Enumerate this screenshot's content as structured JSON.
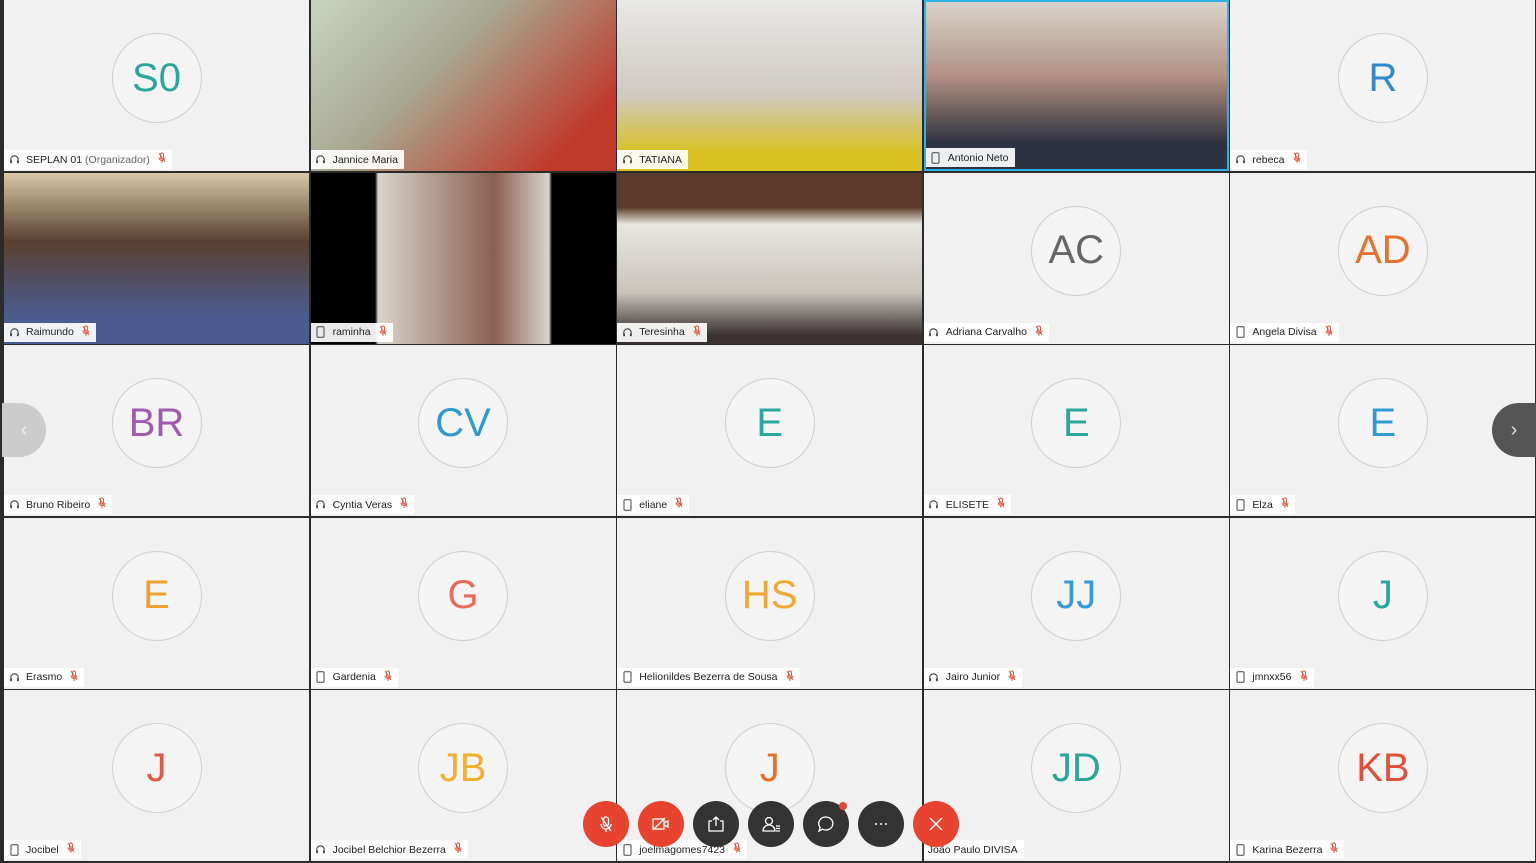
{
  "colors": {
    "active_border": "#2fb2e8",
    "red_button": "#e8432e",
    "dark_button": "#333333",
    "muted_mic": "#e0503a"
  },
  "participants": [
    {
      "name": "SEPLAN 01",
      "role": "(Organizador)",
      "initials": "S0",
      "color": "#2aa79b",
      "device": "headset",
      "muted": true
    },
    {
      "name": "Jannice Maria",
      "video": true,
      "bg": "linear-gradient(135deg,#c9d4c0,#a8a890 40%,#c0392b 85%)",
      "device": "headset",
      "muted": false
    },
    {
      "name": "TATIANA",
      "video": true,
      "bg": "linear-gradient(180deg,#e8e8e6,#cfcac2 55%,#d8c020 90%)",
      "device": "headset",
      "muted": false
    },
    {
      "name": "Antonio Neto",
      "video": true,
      "active": true,
      "bg": "linear-gradient(180deg,#d8d4cc,#b09080 45%,#2c3240 85%)",
      "device": "phone",
      "muted": false
    },
    {
      "name": "rebeca",
      "initials": "R",
      "color": "#2e8bcc",
      "device": "headset",
      "muted": true
    },
    {
      "name": "Raimundo",
      "video": true,
      "bg": "linear-gradient(180deg,#d8c8a8,#5a4030 40%,#4a5c90 85%)",
      "device": "headset",
      "muted": true
    },
    {
      "name": "raminha",
      "video": true,
      "bg": "linear-gradient(90deg,#000 21%,#d8d4cc 22%,#8a6050 60%,#d8d4cc 78%,#000 79%)",
      "device": "phone",
      "muted": true
    },
    {
      "name": "Teresinha",
      "video": true,
      "bg": "linear-gradient(180deg,#5a3a28 20%,#e8e6e0 30%,#c8c4bc 70%,#3a3030 95%)",
      "device": "headset",
      "muted": true
    },
    {
      "name": "Adriana Carvalho",
      "initials": "AC",
      "color": "#666666",
      "device": "headset",
      "muted": true
    },
    {
      "name": "Angela Divisa",
      "initials": "AD",
      "color": "#e8702a",
      "device": "phone",
      "muted": true
    },
    {
      "name": "Bruno Ribeiro",
      "initials": "BR",
      "color": "#a05bb0",
      "device": "headset",
      "muted": true
    },
    {
      "name": "Cyntia Veras",
      "initials": "CV",
      "color": "#2e9bd0",
      "device": "headset",
      "muted": true
    },
    {
      "name": "eliane",
      "initials": "E",
      "color": "#2aa79b",
      "device": "phone",
      "muted": true
    },
    {
      "name": "ELISETE",
      "initials": "E",
      "color": "#2aa79b",
      "device": "headset",
      "muted": true
    },
    {
      "name": "Elza",
      "initials": "E",
      "color": "#2e9bd0",
      "device": "phone",
      "muted": true
    },
    {
      "name": "Erasmo",
      "initials": "E",
      "color": "#f0a030",
      "device": "headset",
      "muted": true
    },
    {
      "name": "Gardenia",
      "initials": "G",
      "color": "#e86a5a",
      "device": "phone",
      "muted": true
    },
    {
      "name": "Helionildes Bezerra de Sousa",
      "initials": "HS",
      "color": "#f0a830",
      "device": "phone",
      "muted": true
    },
    {
      "name": "Jairo Junior",
      "initials": "JJ",
      "color": "#3a9ad8",
      "device": "headset",
      "muted": true
    },
    {
      "name": "jmnxx56",
      "initials": "J",
      "color": "#2aa79b",
      "device": "phone",
      "muted": true
    },
    {
      "name": "Jocibel",
      "initials": "J",
      "color": "#e05a4a",
      "device": "phone",
      "muted": true
    },
    {
      "name": "Jocibel Belchior Bezerra",
      "initials": "JB",
      "color": "#f0b030",
      "device": "headset",
      "muted": true
    },
    {
      "name": "joelmagomes7423",
      "initials": "J",
      "color": "#e8702a",
      "device": "phone",
      "muted": true
    },
    {
      "name": "João Paulo DIVISA",
      "initials": "JD",
      "color": "#2aa79b",
      "device": "none",
      "muted": false
    },
    {
      "name": "Karina Bezerra",
      "initials": "KB",
      "color": "#e0503a",
      "device": "phone",
      "muted": true
    }
  ],
  "toolbar": [
    {
      "id": "mute",
      "icon": "mic-off-icon",
      "style": "red"
    },
    {
      "id": "video",
      "icon": "video-off-icon",
      "style": "red"
    },
    {
      "id": "share",
      "icon": "share-icon",
      "style": "dark"
    },
    {
      "id": "participants",
      "icon": "participants-icon",
      "style": "dark"
    },
    {
      "id": "chat",
      "icon": "chat-icon",
      "style": "dark",
      "badge": true
    },
    {
      "id": "more",
      "icon": "more-icon",
      "style": "dark"
    },
    {
      "id": "leave",
      "icon": "close-icon",
      "style": "red"
    }
  ]
}
